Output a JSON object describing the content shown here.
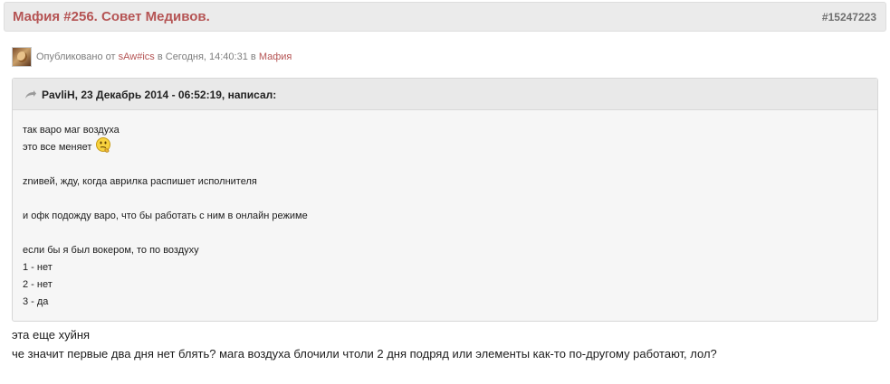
{
  "post": {
    "title": "Мафия #256. Совет Медивов.",
    "number": "#15247223"
  },
  "author_row": {
    "published_label": "Опубликовано от",
    "author": "sAw#ics",
    "in_label": "в",
    "date": "Сегодня, 14:40:31",
    "in_label_2": "в",
    "forum": "Мафия"
  },
  "quote": {
    "citation": "PavliH, 23 Декабрь 2014 - 06:52:19, написал:",
    "lines": [
      "так варо маг воздуха",
      "это все меняет",
      "",
      "znивей, жду, когда аврилка распишет исполнителя",
      "",
      "и офк подожду варо, что бы работать с ним в онлайн режиме",
      "",
      "если бы я был вокером, то по воздуху",
      "1 - нет",
      "2 - нет",
      "3 - да"
    ]
  },
  "reply": {
    "lines": [
      "эта еще хуйня",
      "че значит первые два дня нет блять? мага воздуха блочили чтоли 2 дня подряд или элементы как-то по-другому работают, лол?"
    ]
  }
}
